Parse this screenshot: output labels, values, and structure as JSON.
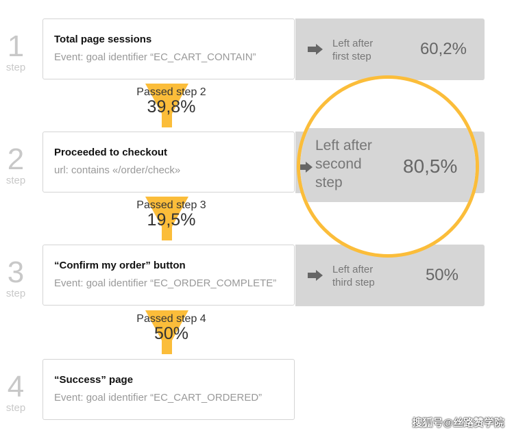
{
  "steps": [
    {
      "number": "1",
      "step_label": "step",
      "title": "Total page sessions",
      "desc": "Event: goal identifier “EC_CART_CONTAIN”",
      "left_label": "Left after first step",
      "left_pct": "60,2%"
    },
    {
      "number": "2",
      "step_label": "step",
      "title": "Proceeded to checkout",
      "desc": "url: contains «/order/check»",
      "left_label": "Left after second step",
      "left_pct": "80,5%"
    },
    {
      "number": "3",
      "step_label": "step",
      "title": "“Confirm my order” button",
      "desc": "Event: goal identifier “EC_ORDER_COMPLETE”",
      "left_label": "Left after third step",
      "left_pct": "50%"
    },
    {
      "number": "4",
      "step_label": "step",
      "title": "“Success” page",
      "desc": "Event: goal identifier “EC_CART_ORDERED”"
    }
  ],
  "passed": [
    {
      "label": "Passed step 2",
      "pct": "39,8%"
    },
    {
      "label": "Passed step 3",
      "pct": "19,5%"
    },
    {
      "label": "Passed step 4",
      "pct": "50%"
    }
  ],
  "left_lines": [
    [
      "Left after",
      "first step"
    ],
    [
      "Left after",
      "second",
      "step"
    ],
    [
      "Left after",
      "third step"
    ]
  ],
  "colors": {
    "accent": "#fbbd3a",
    "panel": "#d6d6d6"
  },
  "watermark": "搜狐号@丝路赞学院"
}
